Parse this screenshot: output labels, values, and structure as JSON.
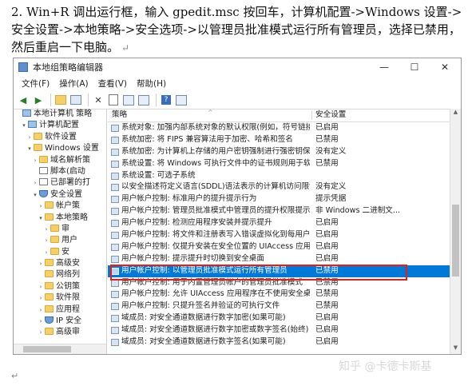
{
  "intro": {
    "text": "2. Win+R 调出运行框，输入 gpedit.msc 按回车，计算机配置->Windows 设置->安全设置->本地策略->安全选项->以管理员批准模式运行所有管理员，选择已禁用，然后重启一下电脑。",
    "return_mark": "↵"
  },
  "window": {
    "title": "本地组策略编辑器",
    "controls": {
      "minimize": "—",
      "maximize": "☐",
      "close": "✕"
    },
    "menu": [
      "文件(F)",
      "操作(A)",
      "查看(V)",
      "帮助(H)"
    ],
    "toolbar_icons": [
      "back-icon",
      "forward-icon",
      "up-folder-icon",
      "show-tree-icon",
      "delete-icon",
      "properties-icon",
      "refresh-icon",
      "export-icon",
      "help-icon",
      "filter-icon"
    ]
  },
  "tree": [
    {
      "label": "本地计算机 策略",
      "icon": "pc",
      "indent": 0,
      "twisty": ""
    },
    {
      "label": "计算机配置",
      "icon": "pc",
      "indent": 1,
      "twisty": "▾"
    },
    {
      "label": "软件设置",
      "icon": "folder",
      "indent": 2,
      "twisty": "›"
    },
    {
      "label": "Windows 设置",
      "icon": "folder",
      "indent": 2,
      "twisty": "▾"
    },
    {
      "label": "域名解析策",
      "icon": "folder",
      "indent": 3,
      "twisty": "›"
    },
    {
      "label": "脚本(启动",
      "icon": "doc",
      "indent": 3,
      "twisty": ""
    },
    {
      "label": "已部署的打",
      "icon": "doc",
      "indent": 3,
      "twisty": "›"
    },
    {
      "label": "安全设置",
      "icon": "shield",
      "indent": 3,
      "twisty": "▾"
    },
    {
      "label": "帐户策",
      "icon": "folder",
      "indent": 4,
      "twisty": "›"
    },
    {
      "label": "本地策略",
      "icon": "folder",
      "indent": 4,
      "twisty": "▾"
    },
    {
      "label": "审",
      "icon": "folder",
      "indent": 5,
      "twisty": "›"
    },
    {
      "label": "用户",
      "icon": "folder",
      "indent": 5,
      "twisty": "›"
    },
    {
      "label": "安",
      "icon": "folder",
      "indent": 5,
      "twisty": "›"
    },
    {
      "label": "高级安",
      "icon": "folder",
      "indent": 4,
      "twisty": "›"
    },
    {
      "label": "网络列",
      "icon": "folder",
      "indent": 4,
      "twisty": ""
    },
    {
      "label": "公钥策",
      "icon": "folder",
      "indent": 4,
      "twisty": "›"
    },
    {
      "label": "软件限",
      "icon": "folder",
      "indent": 4,
      "twisty": "›"
    },
    {
      "label": "应用程",
      "icon": "folder",
      "indent": 4,
      "twisty": "›"
    },
    {
      "label": "IP 安全",
      "icon": "shield",
      "indent": 4,
      "twisty": "›"
    },
    {
      "label": "高级审",
      "icon": "folder",
      "indent": 4,
      "twisty": "›"
    }
  ],
  "list": {
    "col_policy": "策略",
    "col_setting": "安全设置",
    "rows": [
      {
        "name": "系统对象: 加强内部系统对象的默认权限(例如，符号链接)",
        "value": "已启用"
      },
      {
        "name": "系统加密: 将 FIPS 兼容算法用于加密、哈希和签名",
        "value": "已禁用"
      },
      {
        "name": "系统加密: 为计算机上存储的用户密钥强制进行强密钥保护",
        "value": "没有定义"
      },
      {
        "name": "系统设置: 将 Windows 可执行文件中的证书规则用于软件...",
        "value": "已禁用"
      },
      {
        "name": "系统设置: 可选子系统",
        "value": ""
      },
      {
        "name": "以安全描述符定义语言(SDDL)语法表示的计算机访问限制",
        "value": "没有定义"
      },
      {
        "name": "用户帐户控制: 标准用户的提升提示行为",
        "value": "提示凭据"
      },
      {
        "name": "用户帐户控制: 管理员批准模式中管理员的提升权限提示的...",
        "value": "非 Windows 二进制文..."
      },
      {
        "name": "用户帐户控制: 检测应用程序安装并提示提升",
        "value": "已启用"
      },
      {
        "name": "用户帐户控制: 将文件和注册表写入错误虚拟化到每用户位置",
        "value": "已启用"
      },
      {
        "name": "用户帐户控制: 仅提升安装在安全位置的 UIAccess 应用程序",
        "value": "已启用"
      },
      {
        "name": "用户帐户控制: 提示提升时切换到安全桌面",
        "value": "已启用"
      },
      {
        "name": "用户帐户控制: 以管理员批准模式运行所有管理员",
        "value": "已禁用"
      },
      {
        "name": "用户帐户控制: 用于内置管理员帐户的管理员批准模式",
        "value": "已禁用"
      },
      {
        "name": "用户帐户控制: 允许 UIAccess 应用程序在不使用安全桌面...",
        "value": "已禁用"
      },
      {
        "name": "用户帐户控制: 只提升签名并验证的可执行文件",
        "value": "已禁用"
      },
      {
        "name": "域成员: 对安全通道数据进行数字加密(如果可能)",
        "value": "已启用"
      },
      {
        "name": "域成员: 对安全通道数据进行数字加密或数字签名(始终)",
        "value": "已启用"
      },
      {
        "name": "域成员: 对安全通道数据进行数字签名(如果可能)",
        "value": "已启用"
      }
    ],
    "selected_index": 12
  },
  "footer_mark": "↵",
  "watermark": "知乎 @卡德卡斯基",
  "colors": {
    "selection": "#0078d7",
    "highlight_box": "#e3211a"
  }
}
